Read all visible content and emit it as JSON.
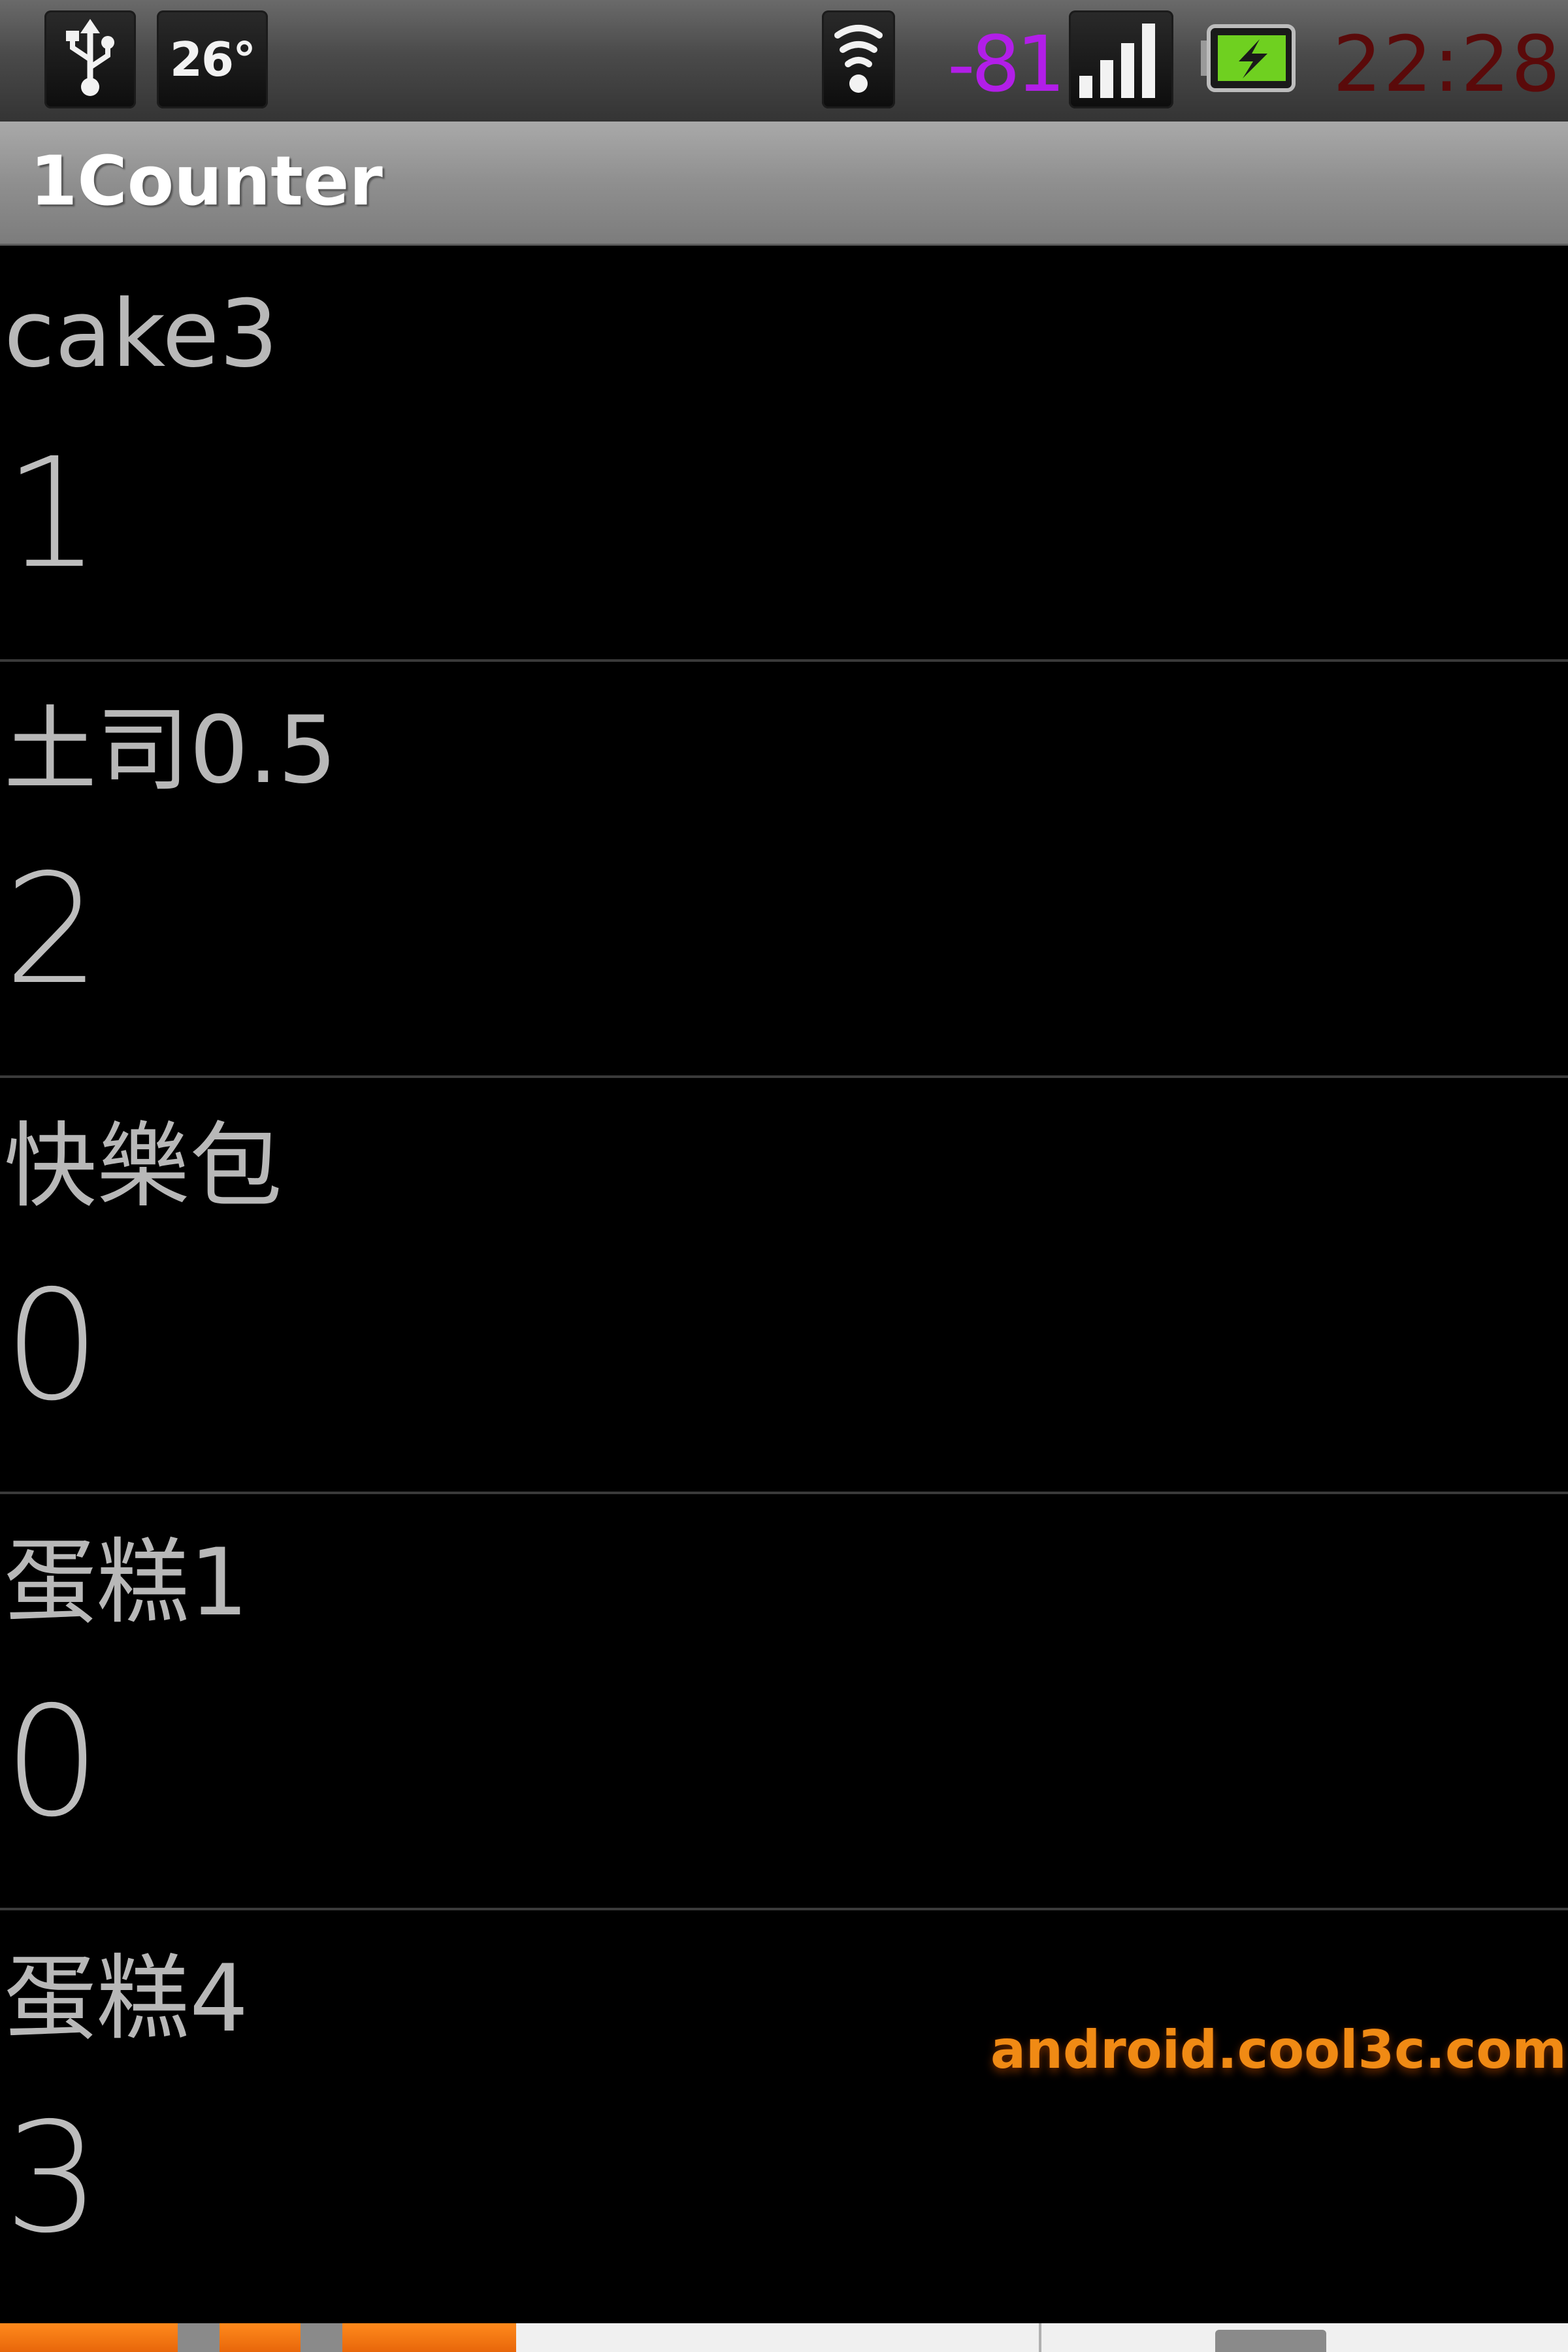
{
  "status_bar": {
    "temperature": "26°",
    "signal_strength": "-81",
    "time": "22:28",
    "icons": [
      "usb-icon",
      "wifi-icon",
      "cell-signal-icon",
      "battery-charging-icon"
    ],
    "colors": {
      "signal_strength": "#b21ee8",
      "time": "#5a0a0a",
      "battery": "#6fd020"
    }
  },
  "app": {
    "title": "1Counter"
  },
  "counters": [
    {
      "name": "cake3",
      "count": "1"
    },
    {
      "name": "土司0.5",
      "count": "2"
    },
    {
      "name": "快樂包",
      "count": "0"
    },
    {
      "name": "蛋糕1",
      "count": "0"
    },
    {
      "name": "蛋糕4",
      "count": "3"
    }
  ],
  "watermark": "android.cool3c.com"
}
